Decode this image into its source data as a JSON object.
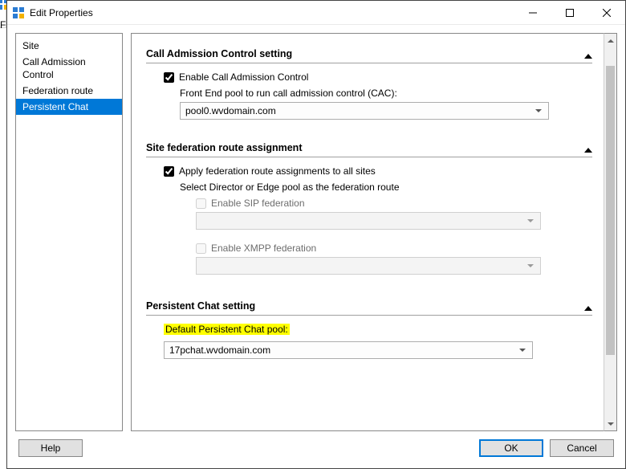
{
  "window": {
    "title": "Edit Properties"
  },
  "left_fragment": "Fi",
  "sidebar": {
    "items": [
      {
        "label": "Site"
      },
      {
        "label": "Call Admission Control"
      },
      {
        "label": "Federation route"
      },
      {
        "label": "Persistent Chat",
        "selected": true
      }
    ]
  },
  "sections": {
    "cac": {
      "title": "Call Admission Control setting",
      "enable_label": "Enable Call Admission Control",
      "enable_checked": true,
      "pool_label": "Front End pool to run call admission control (CAC):",
      "pool_value": "pool0.wvdomain.com"
    },
    "fed": {
      "title": "Site federation route assignment",
      "apply_label": "Apply federation route assignments to all sites",
      "apply_checked": true,
      "select_label": "Select Director or Edge pool as the federation route",
      "sip_label": "Enable SIP federation",
      "sip_checked": false,
      "sip_value": "",
      "xmpp_label": "Enable XMPP federation",
      "xmpp_checked": false,
      "xmpp_value": ""
    },
    "pchat": {
      "title": "Persistent Chat setting",
      "default_label": "Default Persistent Chat pool:",
      "pool_value": "17pchat.wvdomain.com"
    }
  },
  "footer": {
    "help": "Help",
    "ok": "OK",
    "cancel": "Cancel"
  }
}
